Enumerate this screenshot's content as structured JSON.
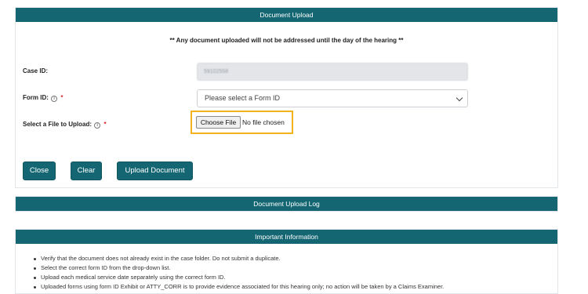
{
  "colors": {
    "header": "#136672",
    "highlight": "#f2b31d",
    "required": "#d9262e"
  },
  "upload": {
    "header": "Document Upload",
    "notice": "** Any document uploaded will not be addressed until the day of the hearing **",
    "case_label": "Case ID:",
    "case_value": "59102558",
    "form_label": "Form ID:",
    "form_placeholder": "Please select a Form ID",
    "file_label": "Select a File to Upload:",
    "required_mark": "*",
    "info_icon": "i",
    "choose_file": "Choose File",
    "file_status": "No file chosen",
    "buttons": {
      "close": "Close",
      "clear": "Clear",
      "upload": "Upload Document"
    }
  },
  "log": {
    "header": "Document Upload Log"
  },
  "info": {
    "header": "Important Information",
    "items": [
      "Verify that the document does not already exist in the case folder. Do not submit a duplicate.",
      "Select the correct form ID from the drop-down list.",
      "Upload each medical service date separately using the correct form ID.",
      "Uploaded forms using form ID Exhibit or ATTY_CORR is to provide evidence associated for this hearing only; no action will be taken by a Claims Examiner."
    ]
  }
}
